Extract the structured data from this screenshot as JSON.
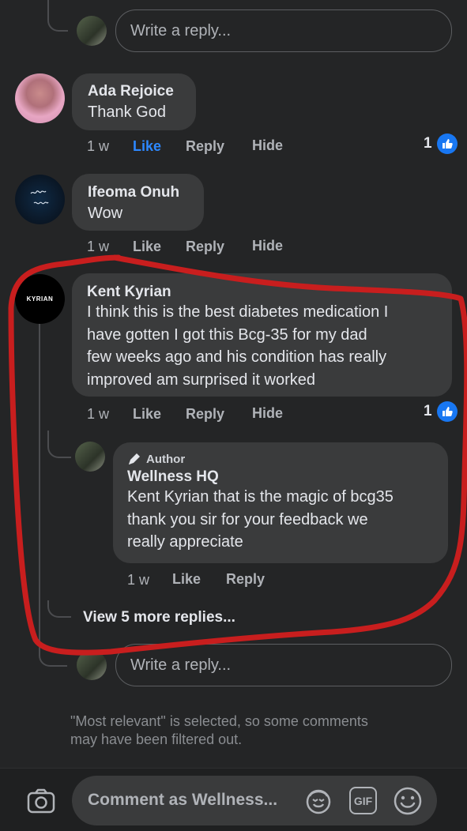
{
  "top_reply": {
    "placeholder": "Write a reply..."
  },
  "comments": [
    {
      "name": "Ada Rejoice",
      "text": "Thank God",
      "time": "1 w",
      "like": "Like",
      "reply": "Reply",
      "hide": "Hide",
      "reactions": "1"
    },
    {
      "name": "Ifeoma Onuh",
      "text": "Wow",
      "time": "1 w",
      "like": "Like",
      "reply": "Reply",
      "hide": "Hide"
    },
    {
      "name": "Kent Kyrian",
      "avatar_text": "KYRIAN",
      "lines": [
        "I think this is the best diabetes medication I",
        "have gotten I got this Bcg-35 for my dad",
        "few weeks ago and his condition has really",
        "improved am surprised it worked"
      ],
      "time": "1 w",
      "like": "Like",
      "reply": "Reply",
      "hide": "Hide",
      "reactions": "1"
    }
  ],
  "author_reply": {
    "badge": "Author",
    "name": "Wellness HQ",
    "lines": [
      "Kent Kyrian that is the magic of bcg35",
      "thank you sir for your feedback we",
      "really appreciate"
    ],
    "time": "1 w",
    "like": "Like",
    "reply": "Reply"
  },
  "more_replies": "View 5 more replies...",
  "bottom_reply": {
    "placeholder": "Write a reply..."
  },
  "filter_notice": [
    "\"Most relevant\" is selected, so some comments",
    "may have been filtered out."
  ],
  "composer": {
    "placeholder": "Comment as Wellness..."
  },
  "colors": {
    "background": "#242526",
    "bubble": "#3a3b3c",
    "link_blue": "#2d88ff",
    "annotation_red": "#c81e1e",
    "like_badge": "#1877f2"
  }
}
